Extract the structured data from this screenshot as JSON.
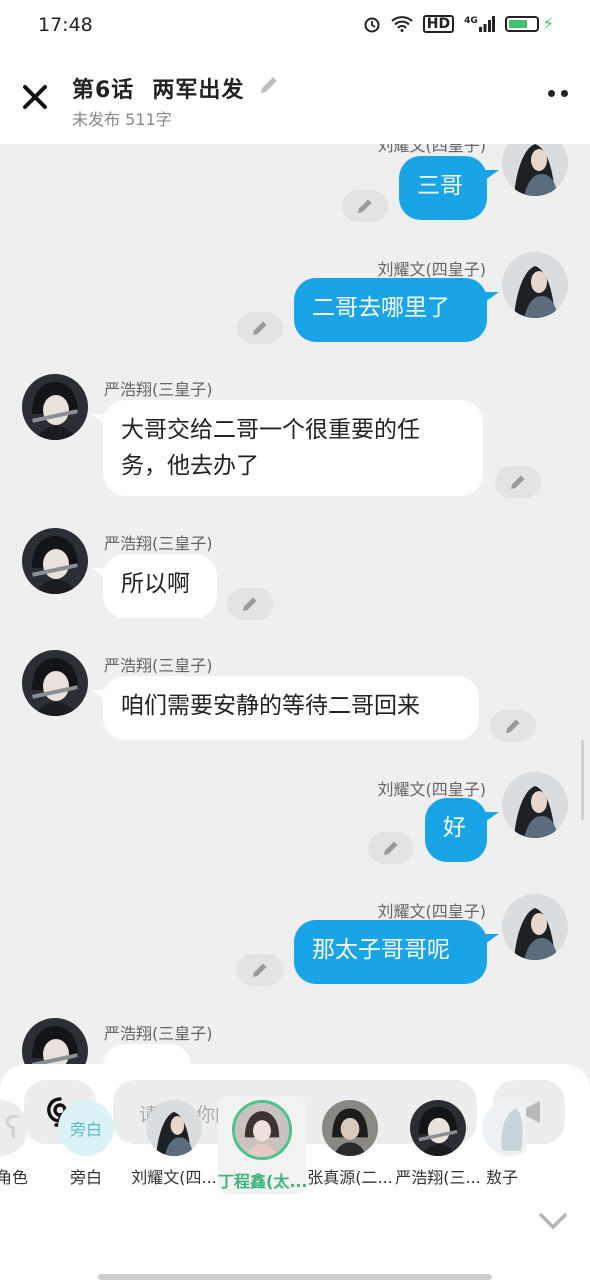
{
  "status": {
    "time": "17:48",
    "hd": "HD",
    "network": "4G"
  },
  "header": {
    "episode": "第6话",
    "title": "两军出发",
    "subtitle": "未发布 511字"
  },
  "messages": [
    {
      "side": "right",
      "name": "刘耀文(四皇子)",
      "text": "三哥"
    },
    {
      "side": "right",
      "name": "刘耀文(四皇子)",
      "text": "二哥去哪里了"
    },
    {
      "side": "left",
      "name": "严浩翔(三皇子)",
      "text": "大哥交给二哥一个很重要的任务，他去办了"
    },
    {
      "side": "left",
      "name": "严浩翔(三皇子)",
      "text": "所以啊"
    },
    {
      "side": "left",
      "name": "严浩翔(三皇子)",
      "text": "咱们需要安静的等待二哥回来"
    },
    {
      "side": "right",
      "name": "刘耀文(四皇子)",
      "text": "好"
    },
    {
      "side": "right",
      "name": "刘耀文(四皇子)",
      "text": "那太子哥哥呢"
    },
    {
      "side": "left",
      "name": "严浩翔(三皇子)",
      "text": ""
    }
  ],
  "composer": {
    "placeholder": "请输入你的脑洞~"
  },
  "roles": [
    {
      "label": "角色",
      "avatar": "role-icon"
    },
    {
      "label": "旁白",
      "badge": "旁白"
    },
    {
      "label": "刘耀文(四..."
    },
    {
      "label": "丁程鑫(太...",
      "selected": true
    },
    {
      "label": "张真源(二..."
    },
    {
      "label": "严浩翔(三..."
    },
    {
      "label": "敖子"
    }
  ],
  "colors": {
    "accent": "#1aa4e8",
    "selected": "#3fb47d"
  }
}
